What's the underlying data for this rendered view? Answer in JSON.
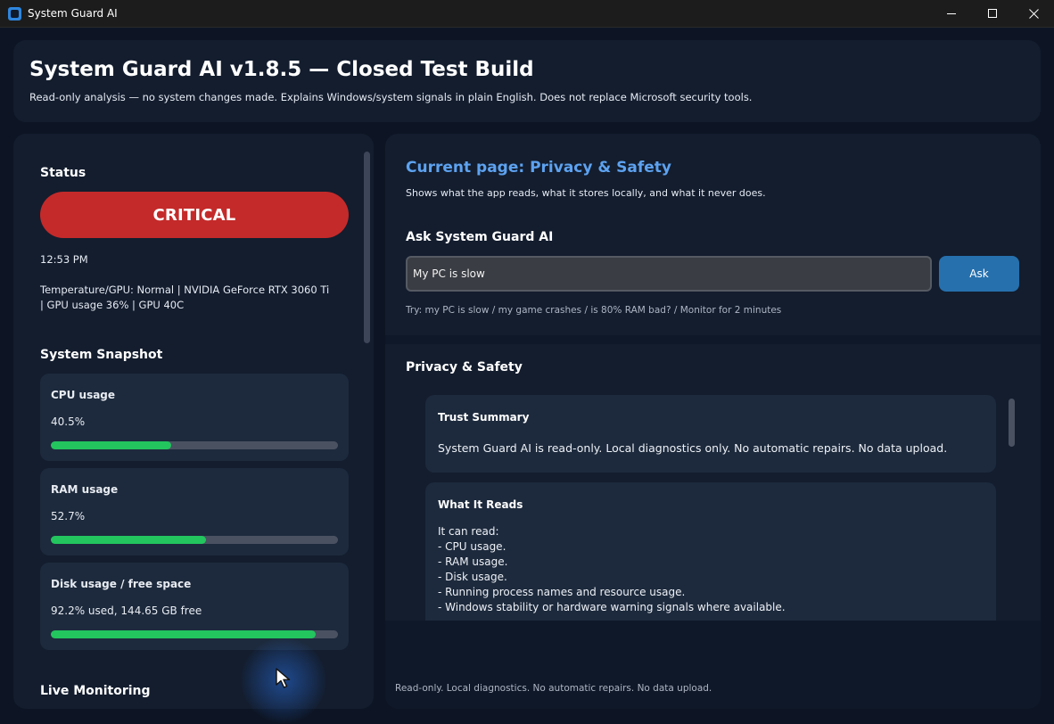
{
  "window": {
    "title": "System Guard AI"
  },
  "header": {
    "title": "System Guard AI v1.8.5 — Closed Test Build",
    "subtitle": "Read-only analysis — no system changes made. Explains Windows/system signals in plain English. Does not replace Microsoft security tools."
  },
  "status": {
    "heading": "Status",
    "level": "CRITICAL",
    "level_color": "#c42a2a",
    "time": "12:53 PM",
    "temperature_line": "Temperature/GPU: Normal | NVIDIA GeForce RTX 3060 Ti | GPU usage 36% | GPU 40C"
  },
  "snapshot": {
    "heading": "System Snapshot",
    "metrics": [
      {
        "label": "CPU usage",
        "value": "40.5%",
        "fill_fraction": 0.42
      },
      {
        "label": "RAM usage",
        "value": "52.7%",
        "fill_fraction": 0.54
      },
      {
        "label": "Disk usage / free space",
        "value": "92.2% used, 144.65 GB free",
        "fill_fraction": 0.922
      }
    ],
    "bar_color": "#22c55e"
  },
  "live_monitoring": {
    "heading": "Live Monitoring"
  },
  "page": {
    "title": "Current page: Privacy & Safety",
    "subtitle": "Shows what the app reads, what it stores locally, and what it never does."
  },
  "ask": {
    "heading": "Ask System Guard AI",
    "input_value": "My PC is slow",
    "button_label": "Ask",
    "hint": "Try: my PC is slow / my game crashes / is 80% RAM bad? / Monitor for 2 minutes"
  },
  "privacy": {
    "heading": "Privacy & Safety",
    "trust_title": "Trust Summary",
    "trust_body": "System Guard AI is read-only. Local diagnostics only. No automatic repairs. No data upload.",
    "reads_title": "What It Reads",
    "reads_intro": "It can read:",
    "reads_items": [
      "- CPU usage.",
      "- RAM usage.",
      "- Disk usage.",
      "- Running process names and resource usage.",
      "- Windows stability or hardware warning signals where available."
    ]
  },
  "footer": {
    "note": "Read-only. Local diagnostics. No automatic repairs. No data upload."
  }
}
